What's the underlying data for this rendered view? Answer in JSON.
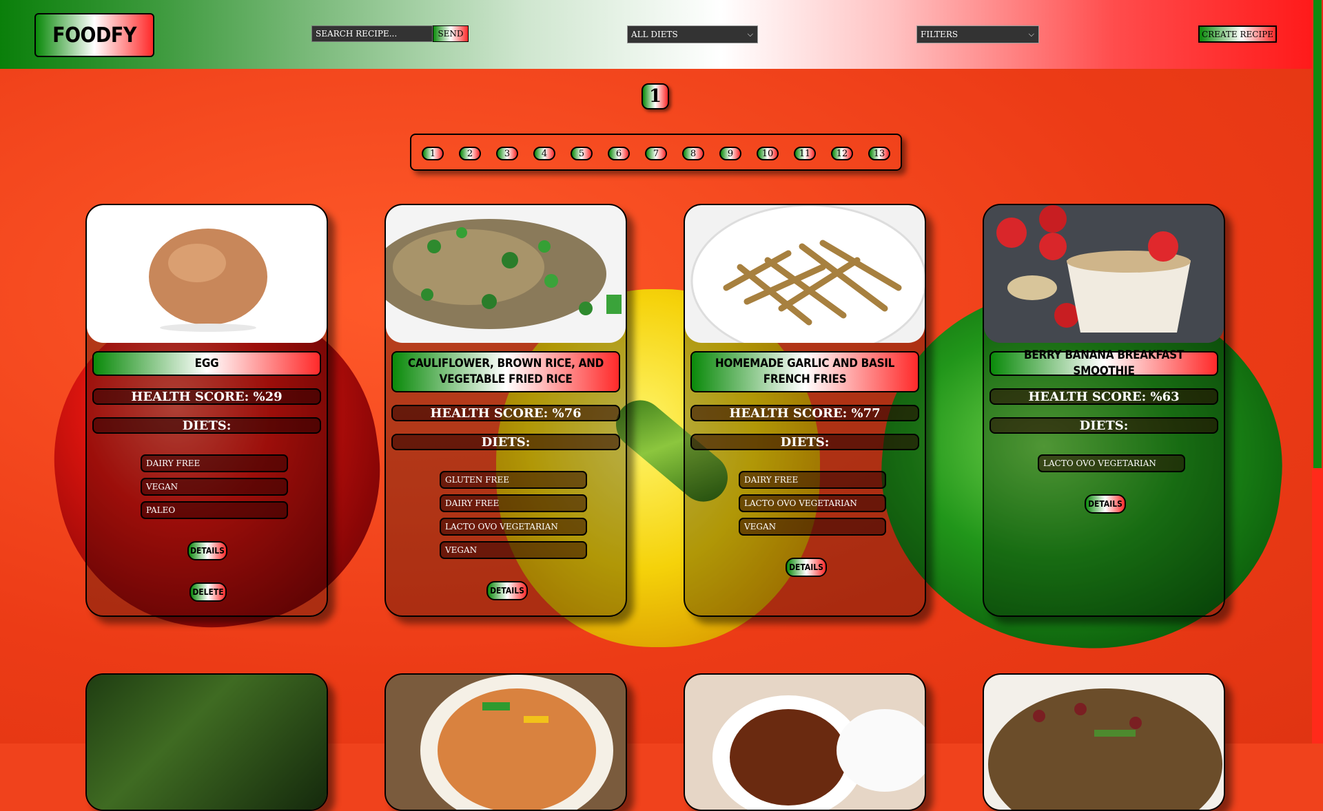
{
  "header": {
    "logo": "FOODFY",
    "search_placeholder": "SEARCH RECIPE...",
    "send_label": "SEND",
    "diets_select": "ALL DIETS",
    "filters_select": "FILTERS",
    "create_label": "CREATE RECIPE"
  },
  "pagination": {
    "current": "1",
    "pages": [
      "1",
      "2",
      "3",
      "4",
      "5",
      "6",
      "7",
      "8",
      "9",
      "10",
      "11",
      "12",
      "13"
    ]
  },
  "cards": [
    {
      "title": "EGG",
      "health_score": "HEALTH SCORE: %29",
      "diets_label": "DIETS:",
      "diets": [
        "DAIRY FREE",
        "VEGAN",
        "PALEO"
      ],
      "details_label": "DETAILS",
      "delete_label": "DELETE"
    },
    {
      "title": "CAULIFLOWER, BROWN RICE, AND VEGETABLE FRIED RICE",
      "health_score": "HEALTH SCORE: %76",
      "diets_label": "DIETS:",
      "diets": [
        "GLUTEN FREE",
        "DAIRY FREE",
        "LACTO OVO VEGETARIAN",
        "VEGAN"
      ],
      "details_label": "DETAILS"
    },
    {
      "title": "HOMEMADE GARLIC AND BASIL FRENCH FRIES",
      "health_score": "HEALTH SCORE: %77",
      "diets_label": "DIETS:",
      "diets": [
        "DAIRY FREE",
        "LACTO OVO VEGETARIAN",
        "VEGAN"
      ],
      "details_label": "DETAILS"
    },
    {
      "title": "BERRY BANANA BREAKFAST SMOOTHIE",
      "health_score": "HEALTH SCORE: %63",
      "diets_label": "DIETS:",
      "diets": [
        "LACTO OVO VEGETARIAN"
      ],
      "details_label": "DETAILS"
    }
  ],
  "colors": {
    "accent_green": "#0a8a0a",
    "accent_red": "#ff2a2a",
    "background": "#f0421c"
  }
}
